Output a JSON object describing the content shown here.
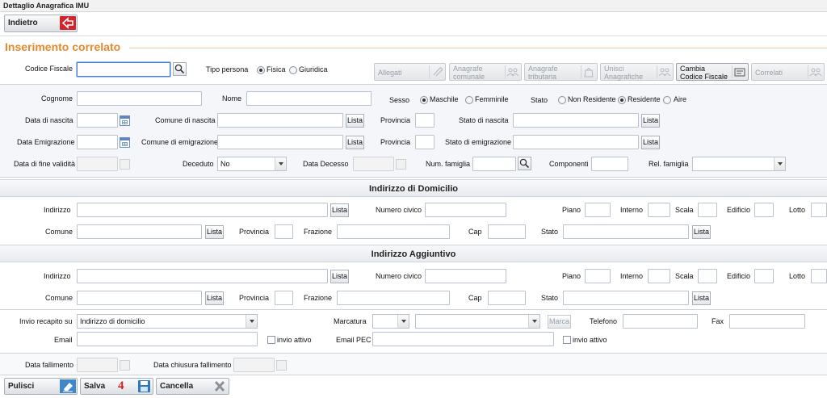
{
  "window": {
    "title": "Dettaglio Anagrafica IMU"
  },
  "toolbar": {
    "back_label": "Indietro"
  },
  "section_title": "Inserimento correlato",
  "top": {
    "codice_fiscale_label": "Codice Fiscale",
    "tipo_persona_label": "Tipo persona",
    "fisica_label": "Fisica",
    "giuridica_label": "Giuridica"
  },
  "actions": {
    "allegati": "Allegati",
    "anagrafe_comunale_1": "Anagrafe",
    "anagrafe_comunale_2": "comunale",
    "anagrafe_tributaria_1": "Anagrafe",
    "anagrafe_tributaria_2": "tributaria",
    "unisci_1": "Unisci",
    "unisci_2": "Anagrafiche",
    "cambia_1": "Cambia",
    "cambia_2": "Codice Fiscale",
    "correlati": "Correlati"
  },
  "anag": {
    "cognome": "Cognome",
    "nome": "Nome",
    "sesso": "Sesso",
    "maschile": "Maschile",
    "femminile": "Femminile",
    "stato": "Stato",
    "non_residente": "Non Residente",
    "residente": "Residente",
    "aire": "Aire",
    "data_nascita": "Data di nascita",
    "comune_nascita": "Comune di nascita",
    "provincia": "Provincia",
    "stato_nascita": "Stato di nascita",
    "data_emigrazione": "Data Emigrazione",
    "comune_emigrazione": "Comune di emigrazione",
    "stato_emigrazione": "Stato di emigrazione",
    "data_fine_validita": "Data di fine validità",
    "deceduto": "Deceduto",
    "deceduto_value": "No",
    "data_decesso": "Data Decesso",
    "num_famiglia": "Num. famiglia",
    "componenti": "Componenti",
    "rel_famiglia": "Rel. famiglia"
  },
  "lista_label": "Lista",
  "domicilio": {
    "title": "Indirizzo di Domicilio",
    "indirizzo": "Indirizzo",
    "numero_civico": "Numero civico",
    "piano": "Piano",
    "interno": "Interno",
    "scala": "Scala",
    "edificio": "Edificio",
    "lotto": "Lotto",
    "comune": "Comune",
    "provincia": "Provincia",
    "frazione": "Frazione",
    "cap": "Cap",
    "stato": "Stato"
  },
  "aggiuntivo": {
    "title": "Indirizzo Aggiuntivo",
    "indirizzo": "Indirizzo",
    "numero_civico": "Numero civico",
    "piano": "Piano",
    "interno": "Interno",
    "scala": "Scala",
    "edificio": "Edificio",
    "lotto": "Lotto",
    "comune": "Comune",
    "provincia": "Provincia",
    "frazione": "Frazione",
    "cap": "Cap",
    "stato": "Stato"
  },
  "contatti": {
    "invio_recapito": "Invio recapito su",
    "invio_value": "Indirizzo di domicilio",
    "marcatura": "Marcatura",
    "marca_button": "Marca",
    "telefono": "Telefono",
    "fax": "Fax",
    "email": "Email",
    "invio_attivo": "invio attivo",
    "email_pec": "Email PEC"
  },
  "fallimento": {
    "data_fallimento": "Data fallimento",
    "data_chiusura": "Data chiusura fallimento"
  },
  "footer": {
    "pulisci": "Pulisci",
    "salva": "Salva",
    "badge": "4",
    "cancella": "Cancella"
  }
}
